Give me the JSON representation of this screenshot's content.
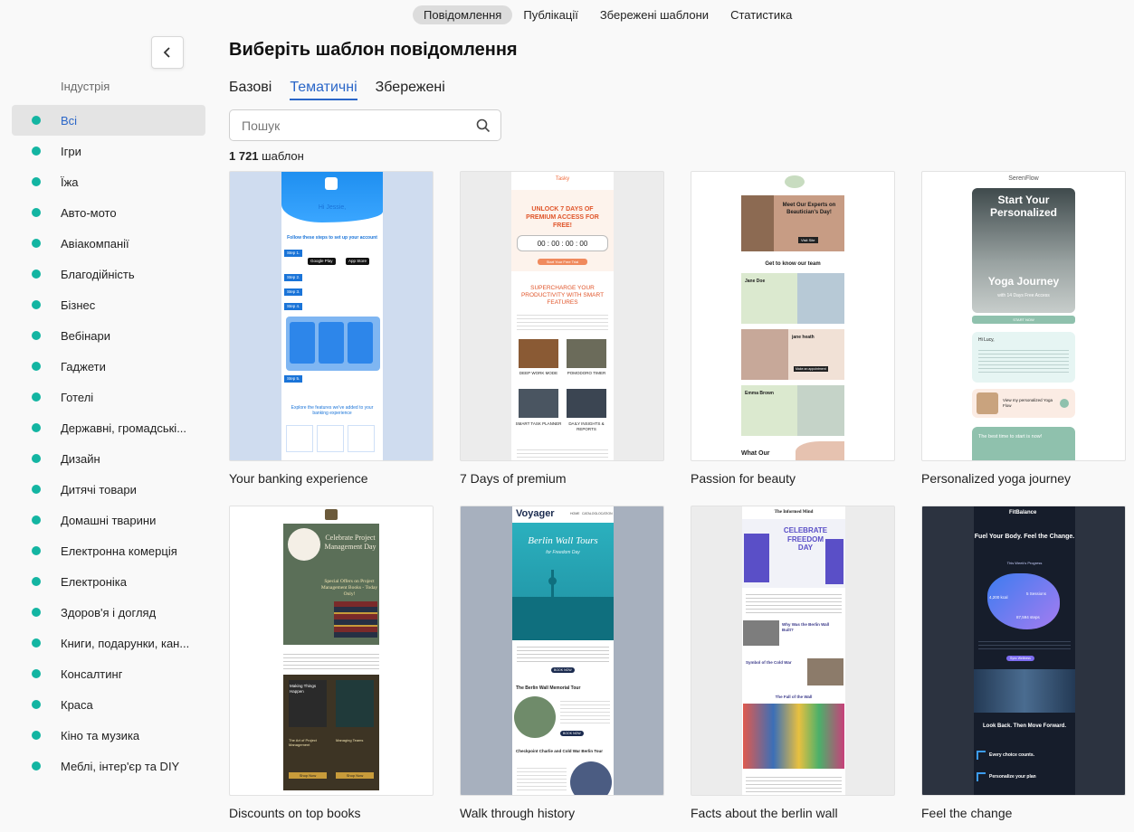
{
  "topnav": {
    "tabs": [
      "Повідомлення",
      "Публікації",
      "Збережені шаблони",
      "Статистика"
    ]
  },
  "sidebar": {
    "heading": "Індустрія",
    "items": [
      "Всі",
      "Ігри",
      "Їжа",
      "Авто-мото",
      "Авіакомпанії",
      "Благодійність",
      "Бізнес",
      "Вебінари",
      "Гаджети",
      "Готелі",
      "Державні, громадські...",
      "Дизайн",
      "Дитячі товари",
      "Домашні тварини",
      "Електронна комерція",
      "Електроніка",
      "Здоров'я і догляд",
      "Книги, подарунки, кан...",
      "Консалтинг",
      "Краса",
      "Кіно та музика",
      "Меблі, інтер'єр та DIY"
    ],
    "accent": "#13b5a2"
  },
  "main": {
    "title": "Виберіть шаблон повідомлення",
    "subtabs": [
      "Базові",
      "Тематичні",
      "Збережені"
    ],
    "search_placeholder": "Пошук",
    "count_number": "1 721",
    "count_unit": "шаблон",
    "accent": "#2a66c8",
    "templates": [
      {
        "title": "Your banking experience",
        "preview": {
          "greeting": "Hi Jessie,",
          "heading": "Follow these steps to set up your account",
          "steps": [
            "Step 1.",
            "Step 2.",
            "Step 3.",
            "Step 4.",
            "Step 5."
          ],
          "badge_google": "Google Play",
          "badge_apple": "App Store",
          "footer_heading": "Explore the features we've added to your banking experience"
        }
      },
      {
        "title": "7 Days of premium",
        "preview": {
          "brand": "Tasky",
          "headline": "UNLOCK 7 DAYS OF PREMIUM ACCESS FOR FREE!",
          "timer": "00 : 00 : 00 : 00",
          "cta": "Start Your Free Trial",
          "subhead": "SUPERCHARGE YOUR PRODUCTIVITY WITH SMART FEATURES",
          "features": [
            "DEEP WORK MODE",
            "POMODORO TIMER",
            "SMART TASK PLANNER",
            "DAILY INSIGHTS & REPORTS"
          ]
        }
      },
      {
        "title": "Passion for beauty",
        "preview": {
          "hero": "Meet Our Experts on Beautician's Day!",
          "button": "Visit Site",
          "team_heading": "Get to know our team",
          "members": [
            "Jane Doe",
            "jane heath",
            "Emma Brown"
          ],
          "member_button": "Make an appointment",
          "footer": "What Our"
        }
      },
      {
        "title": "Personalized yoga journey",
        "preview": {
          "brand": "SerenFlow",
          "hero_title": "Start Your Personalized",
          "hero_sub": "Yoga Journey",
          "hero_caption": "with 14 Days Free Access",
          "cta": "START NOW",
          "greeting": "Hi Lucy,",
          "video": "View my personalized Yoga Flow",
          "bottom": "The best time to start is now!"
        }
      },
      {
        "title": "Discounts on top books",
        "preview": {
          "hero": "Celebrate Project Management Day",
          "offer": "Special Offers on Project Management Books - Today Only!",
          "books": [
            "Making Things Happen",
            "The Art of Project Management",
            "Managing Teams"
          ],
          "button": "Shop Now"
        }
      },
      {
        "title": "Walk through history",
        "preview": {
          "brand": "Voyager",
          "nav": [
            "HOME",
            "CATALOG",
            "LOCATION"
          ],
          "hero": "Berlin Wall Tours",
          "hero_sub": "for Freedom Day",
          "tour1": "The Berlin Wall Memorial Tour",
          "tour2": "Checkpoint Charlie and Cold War Berlin Tour",
          "button": "BOOK NOW"
        }
      },
      {
        "title": "Facts about the berlin wall",
        "preview": {
          "brand": "The Informed Mind",
          "hero": "CELEBRATE FREEDOM DAY",
          "q1": "Why Was the Berlin Wall Built?",
          "q2": "Symbol of the Cold War",
          "q3": "The Fall of the Wall"
        }
      },
      {
        "title": "Feel the change",
        "preview": {
          "brand": "FitBalance",
          "tagline": "Fuel Your Body. Feel the Change.",
          "progress": "This Week's Progress",
          "stat1": "4,200 kcal",
          "stat2": "5 Sessions",
          "stat3": "87,594 steps",
          "button": "Sync Wellness",
          "headline2": "Look Back. Then Move Forward.",
          "footer1": "Every choice counts.",
          "footer2": "Personalize your plan"
        }
      }
    ]
  }
}
